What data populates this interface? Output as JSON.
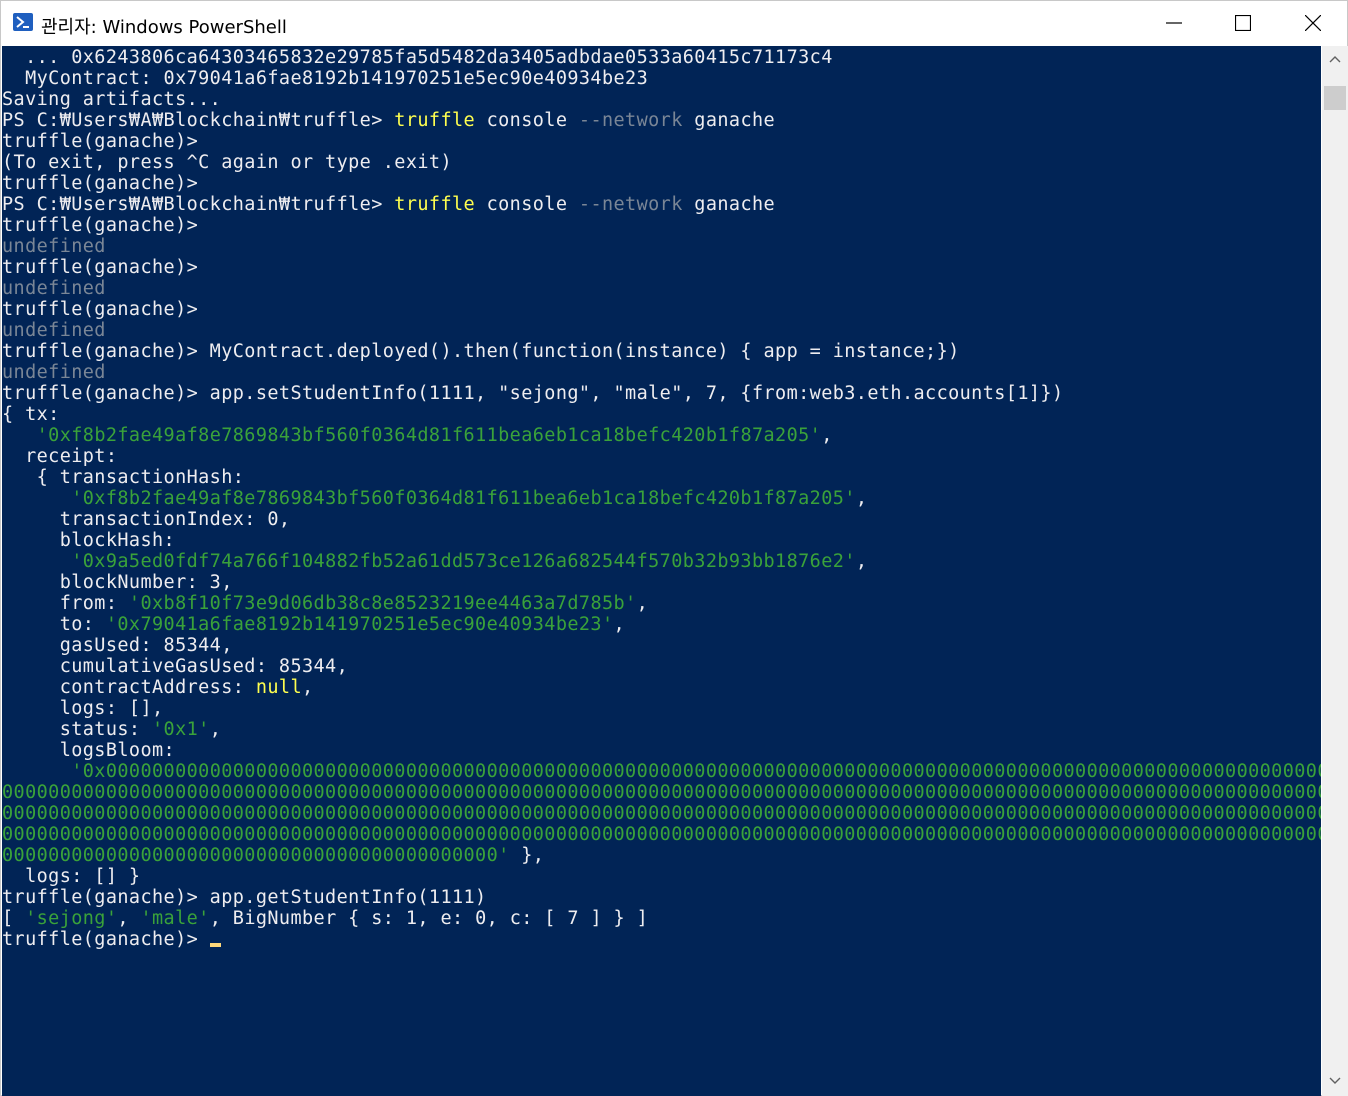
{
  "window": {
    "title": "관리자: Windows PowerShell",
    "controls": {
      "minimize_icon": "minimize-icon",
      "maximize_icon": "maximize-icon",
      "close_icon": "close-icon"
    }
  },
  "colors": {
    "console_bg": "#012456",
    "text": "#eeedf0",
    "string_green": "#3aa23a",
    "undefined_gray": "#7a8696",
    "null_yellow": "#ffff4f",
    "cursor": "#fdd87b"
  },
  "console": {
    "lines": [
      [
        {
          "t": "  ... 0x6243806ca64303465832e29785fa5d5482da3405adbdae0533a60415c71173c4"
        }
      ],
      [
        {
          "t": "  MyContract: 0x79041a6fae8192b141970251e5ec90e40934be23"
        }
      ],
      [
        {
          "t": "Saving artifacts..."
        }
      ],
      [
        {
          "t": "PS C:₩Users₩A₩Blockchain₩truffle> "
        },
        {
          "t": "truffle",
          "c": "y"
        },
        {
          "t": " console "
        },
        {
          "t": "--network",
          "c": "gy"
        },
        {
          "t": " ganache"
        }
      ],
      [
        {
          "t": "truffle(ganache)>"
        }
      ],
      [
        {
          "t": "(To exit, press ^C again or type .exit)"
        }
      ],
      [
        {
          "t": "truffle(ganache)>"
        }
      ],
      [
        {
          "t": "PS C:₩Users₩A₩Blockchain₩truffle> "
        },
        {
          "t": "truffle",
          "c": "y"
        },
        {
          "t": " console "
        },
        {
          "t": "--network",
          "c": "gy"
        },
        {
          "t": " ganache"
        }
      ],
      [
        {
          "t": "truffle(ganache)>"
        }
      ],
      [
        {
          "t": "undefined",
          "c": "gy"
        }
      ],
      [
        {
          "t": "truffle(ganache)>"
        }
      ],
      [
        {
          "t": "undefined",
          "c": "gy"
        }
      ],
      [
        {
          "t": "truffle(ganache)>"
        }
      ],
      [
        {
          "t": "undefined",
          "c": "gy"
        }
      ],
      [
        {
          "t": "truffle(ganache)> MyContract.deployed().then(function(instance) { app = instance;})"
        }
      ],
      [
        {
          "t": "undefined",
          "c": "gy"
        }
      ],
      [
        {
          "t": "truffle(ganache)> app.setStudentInfo(1111, \"sejong\", \"male\", 7, {from:web3.eth.accounts[1]})"
        }
      ],
      [
        {
          "t": "{ tx:"
        }
      ],
      [
        {
          "t": "   "
        },
        {
          "t": "'0xf8b2fae49af8e7869843bf560f0364d81f611bea6eb1ca18befc420b1f87a205'",
          "c": "g"
        },
        {
          "t": ","
        }
      ],
      [
        {
          "t": "  receipt:"
        }
      ],
      [
        {
          "t": "   { transactionHash:"
        }
      ],
      [
        {
          "t": "      "
        },
        {
          "t": "'0xf8b2fae49af8e7869843bf560f0364d81f611bea6eb1ca18befc420b1f87a205'",
          "c": "g"
        },
        {
          "t": ","
        }
      ],
      [
        {
          "t": "     transactionIndex: 0,"
        }
      ],
      [
        {
          "t": "     blockHash:"
        }
      ],
      [
        {
          "t": "      "
        },
        {
          "t": "'0x9a5ed0fdf74a766f104882fb52a61dd573ce126a682544f570b32b93bb1876e2'",
          "c": "g"
        },
        {
          "t": ","
        }
      ],
      [
        {
          "t": "     blockNumber: 3,"
        }
      ],
      [
        {
          "t": "     from: "
        },
        {
          "t": "'0xb8f10f73e9d06db38c8e8523219ee4463a7d785b'",
          "c": "g"
        },
        {
          "t": ","
        }
      ],
      [
        {
          "t": "     to: "
        },
        {
          "t": "'0x79041a6fae8192b141970251e5ec90e40934be23'",
          "c": "g"
        },
        {
          "t": ","
        }
      ],
      [
        {
          "t": "     gasUsed: 85344,"
        }
      ],
      [
        {
          "t": "     cumulativeGasUsed: 85344,"
        }
      ],
      [
        {
          "t": "     contractAddress: "
        },
        {
          "t": "null",
          "c": "y"
        },
        {
          "t": ","
        }
      ],
      [
        {
          "t": "     logs: [],"
        }
      ],
      [
        {
          "t": "     status: "
        },
        {
          "t": "'0x1'",
          "c": "g"
        },
        {
          "t": ","
        }
      ],
      [
        {
          "t": "     logsBloom:"
        }
      ],
      [
        {
          "t": "      "
        },
        {
          "t": "'0x00000000000000000000000000000000000000000000000000000000000000000000000000000000000000000000000000000000000000",
          "c": "g"
        }
      ],
      [
        {
          "t": "0000000000000000000000000000000000000000000000000000000000000000000000000000000000000000000000000000000000000000000000000",
          "c": "g"
        }
      ],
      [
        {
          "t": "0000000000000000000000000000000000000000000000000000000000000000000000000000000000000000000000000000000000000000000000000",
          "c": "g"
        }
      ],
      [
        {
          "t": "0000000000000000000000000000000000000000000000000000000000000000000000000000000000000000000000000000000000000000000000000",
          "c": "g"
        }
      ],
      [
        {
          "t": "0000000000000000000000000000000000000000000'",
          "c": "g"
        },
        {
          "t": " },"
        }
      ],
      [
        {
          "t": "  logs: [] }"
        }
      ],
      [
        {
          "t": "truffle(ganache)> app.getStudentInfo(1111)"
        }
      ],
      [
        {
          "t": "[ "
        },
        {
          "t": "'sejong'",
          "c": "g"
        },
        {
          "t": ", "
        },
        {
          "t": "'male'",
          "c": "g"
        },
        {
          "t": ", BigNumber { s: 1, e: 0, c: [ 7 ] } ]"
        }
      ],
      [
        {
          "t": "truffle(ganache)> "
        },
        {
          "cursor": true
        }
      ]
    ]
  },
  "scrollbar": {
    "up_icon": "chevron-up-icon",
    "down_icon": "chevron-down-icon"
  }
}
